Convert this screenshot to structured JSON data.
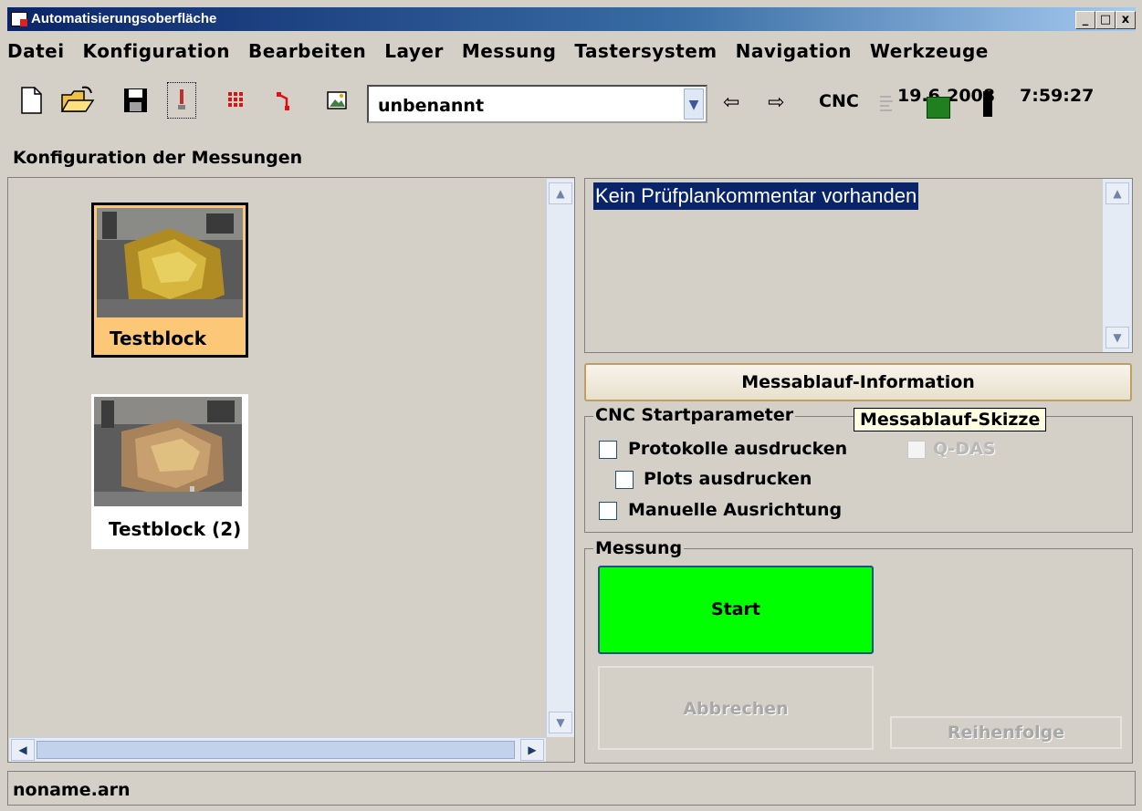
{
  "window": {
    "title": "Automatisierungsoberfläche",
    "minimize": "_",
    "maximize": "□",
    "close": "x"
  },
  "menu": [
    "Datei",
    "Konfiguration",
    "Bearbeiten",
    "Layer",
    "Messung",
    "Tastersystem",
    "Navigation",
    "Werkzeuge"
  ],
  "toolbar": {
    "icons": [
      "new-file-icon",
      "open-folder-icon",
      "save-icon",
      "probe-icon",
      "grid-points-icon",
      "path-icon",
      "image-icon"
    ],
    "combo_value": "unbenannt",
    "back_icon": "⇦",
    "forward_icon": "⇨",
    "cnc_label": "CNC",
    "date": "19.6.2008",
    "time": "7:59:27"
  },
  "section_title": "Konfiguration der Messungen",
  "items": [
    {
      "label": "Testblock",
      "selected": true
    },
    {
      "label": "Testblock (2)",
      "selected": false
    }
  ],
  "comment": "Kein Prüfplankommentar vorhanden",
  "info_button": "Messablauf-Information",
  "cnc_group": {
    "title": "CNC Startparameter",
    "tooltip": "Messablauf-Skizze",
    "protokolle": "Protokolle ausdrucken",
    "plots": "Plots ausdrucken",
    "manuell": "Manuelle Ausrichtung",
    "qdas": "Q-DAS"
  },
  "messung_group": {
    "title": "Messung",
    "start": "Start",
    "abbrechen": "Abbrechen",
    "reihenfolge": "Reihenfolge"
  },
  "status": "noname.arn",
  "colors": {
    "start_green": "#00ff00",
    "selection": "#0a246a",
    "selected_item": "#fcc878"
  }
}
